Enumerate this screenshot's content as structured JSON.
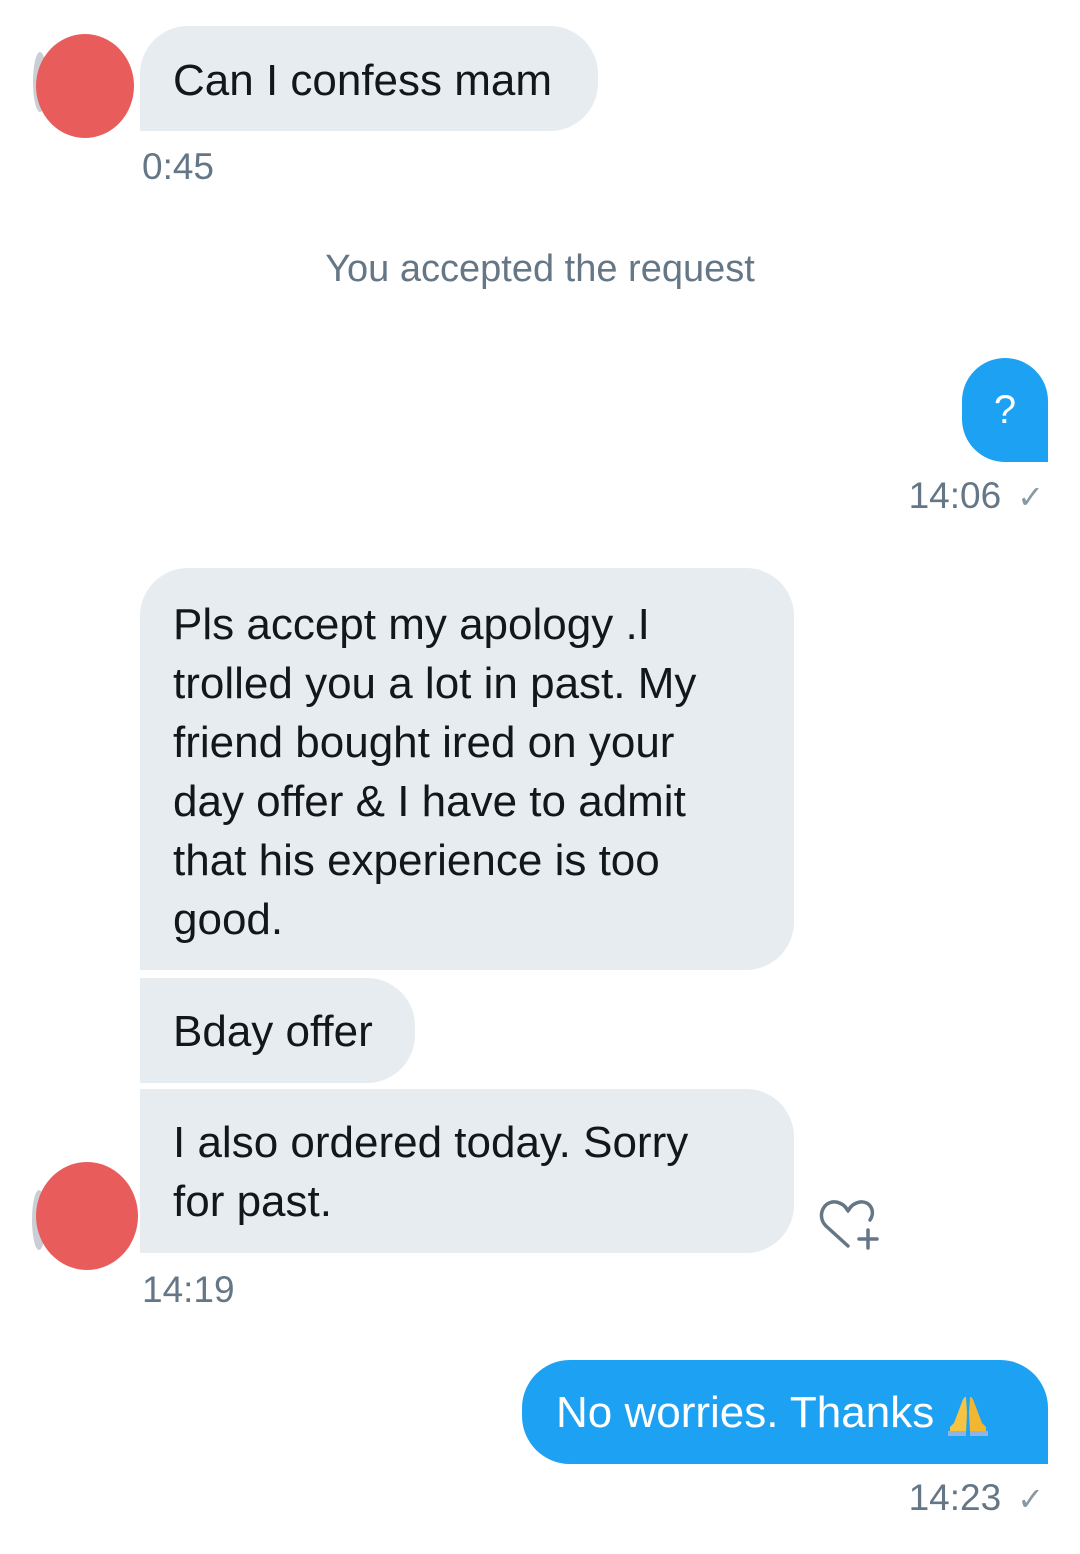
{
  "conversation": {
    "messages": [
      {
        "id": "m1",
        "direction": "incoming",
        "text": "Can I confess mam",
        "time": "0:45"
      },
      {
        "id": "sys1",
        "direction": "system",
        "text": "You accepted the request"
      },
      {
        "id": "m2",
        "direction": "outgoing",
        "text": "?",
        "time": "14:06",
        "status_icon": "check-icon"
      },
      {
        "id": "m3",
        "direction": "incoming",
        "lines": [
          "Pls accept my apology .I",
          "trolled you a lot in past. My",
          "friend bought ired on your",
          "day offer & I have to admit",
          "that his experience is too",
          "good."
        ]
      },
      {
        "id": "m4",
        "direction": "incoming",
        "text": "Bday offer"
      },
      {
        "id": "m5",
        "direction": "incoming",
        "lines": [
          "I also ordered today. Sorry",
          "for past."
        ],
        "time": "14:19",
        "action_icon": "like-heart-plus-icon"
      },
      {
        "id": "m6",
        "direction": "outgoing",
        "text": "No worries. Thanks",
        "emoji": "folded-hands-emoji",
        "time": "14:23",
        "status_icon": "check-icon"
      }
    ]
  },
  "colors": {
    "incoming_bubble": "#e6ecf0",
    "outgoing_bubble": "#1da1f2",
    "timestamp": "#657786",
    "avatar_redaction": "#e85c5c"
  },
  "icons": {
    "check": "✓"
  }
}
